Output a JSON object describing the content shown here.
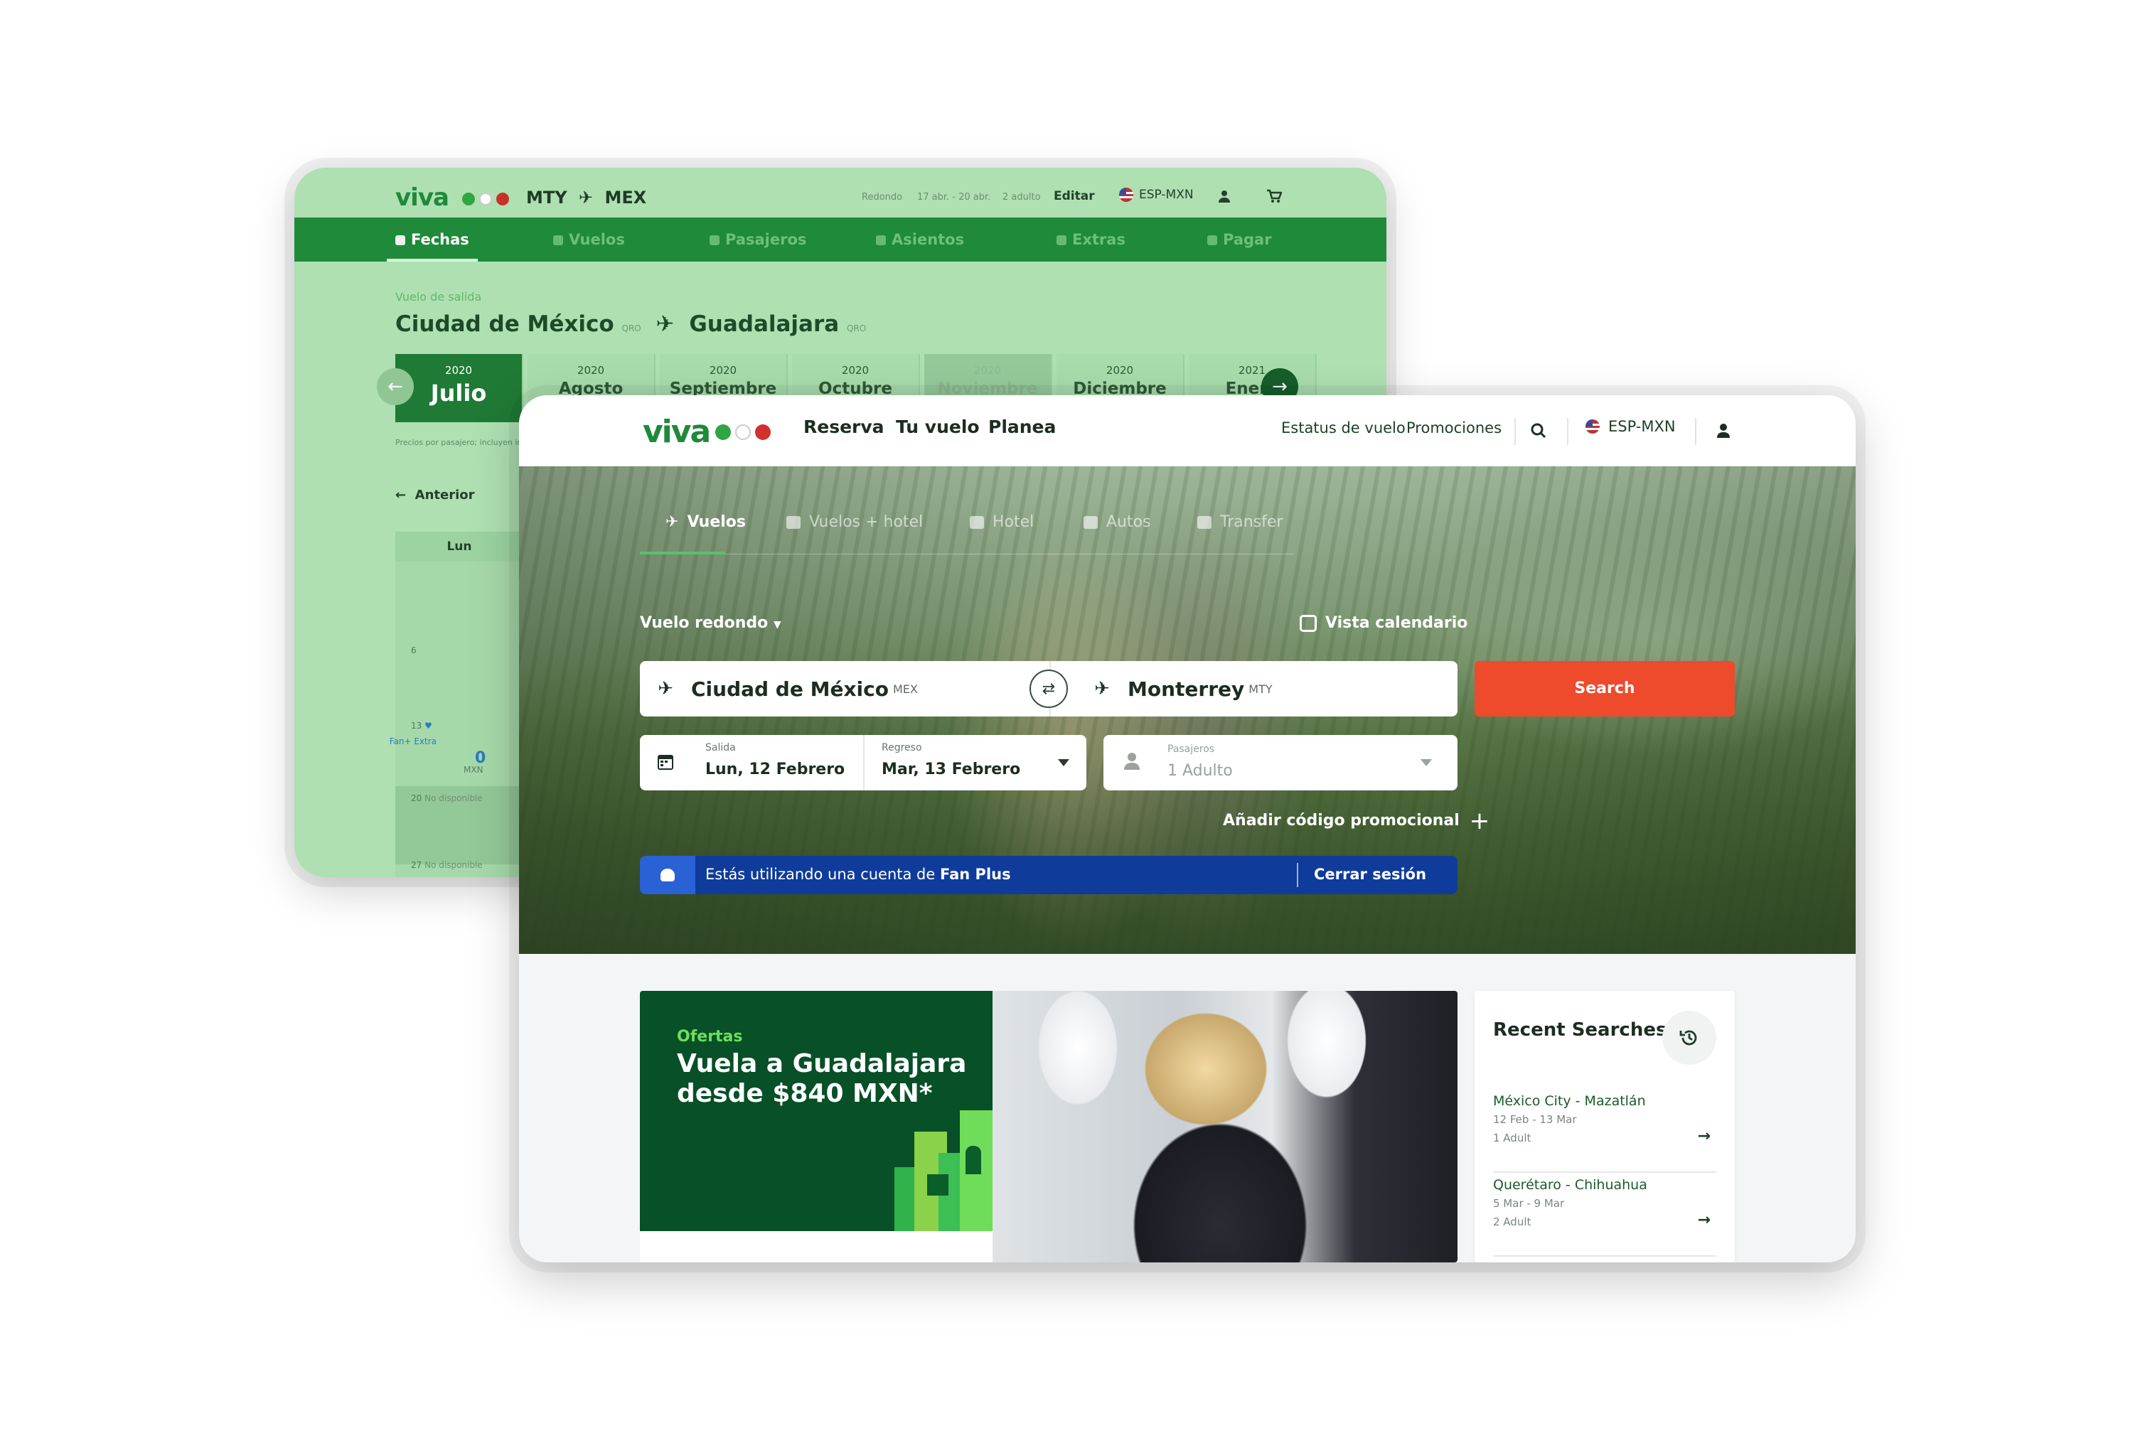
{
  "back": {
    "logo": "viva",
    "route_from": "MTY",
    "route_to": "MEX",
    "trip_type": "Redondo",
    "dates": "17 abr. - 20 abr.",
    "passengers": "2 adulto",
    "edit_label": "Editar",
    "lang": "ESP-MXN",
    "steps": [
      "Fechas",
      "Vuelos",
      "Pasajeros",
      "Asientos",
      "Extras",
      "Pagar"
    ],
    "subtitle": "Vuelo de salida",
    "origin": "Ciudad de México",
    "origin_code": "QRO",
    "destination": "Guadalajara",
    "destination_code": "QRO",
    "months": [
      {
        "year": "2020",
        "name": "Julio"
      },
      {
        "year": "2020",
        "name": "Agosto"
      },
      {
        "year": "2020",
        "name": "Septiembre"
      },
      {
        "year": "2020",
        "name": "Octubre"
      },
      {
        "year": "2020",
        "name": "Noviembre"
      },
      {
        "year": "2020",
        "name": "Diciembre"
      },
      {
        "year": "2021",
        "name": "Enero"
      }
    ],
    "price_note": "Precios por pasajero; incluyen im",
    "prev_label": "Anterior",
    "weekday": "Lun",
    "day_6": "6",
    "day_13": "13",
    "fan_extra": "Fan+ Extra",
    "day_13_price": "0",
    "currency": "MXN",
    "day_20": "20",
    "day_27": "27",
    "not_available": "No disponible"
  },
  "front": {
    "logo": "viva",
    "menu": [
      "Reserva",
      "Tu vuelo",
      "Planea"
    ],
    "links": [
      "Estatus de vuelo",
      "Promociones"
    ],
    "lang": "ESP-MXN",
    "tabs": [
      "Vuelos",
      "Vuelos + hotel",
      "Hotel",
      "Autos",
      "Transfer"
    ],
    "trip_type": "Vuelo redondo",
    "calendar_view": "Vista calendario",
    "origin": "Ciudad de México",
    "origin_code": "MEX",
    "destination": "Monterrey",
    "destination_code": "MTY",
    "search_label": "Search",
    "departure_label": "Salida",
    "departure_value": "Lun, 12 Febrero",
    "return_label": "Regreso",
    "return_value": "Mar, 13 Febrero",
    "pax_label": "Pasajeros",
    "pax_value": "1 Adulto",
    "promo_label": "Añadir código promocional",
    "fan_text": "Estás utilizando una cuenta de",
    "fan_brand": "Fan Plus",
    "logout_label": "Cerrar sesión",
    "offer_label": "Ofertas",
    "offer_title": "Vuela a Guadalajara desde $840 MXN*",
    "recent_title": "Recent Searches",
    "recent": [
      {
        "route": "México City - Mazatlán",
        "dates": "12 Feb - 13 Mar",
        "pax": "1 Adult"
      },
      {
        "route": "Querétaro - Chihuahua",
        "dates": "5 Mar - 9 Mar",
        "pax": "2 Adult"
      }
    ]
  },
  "colors": {
    "brand_green": "#1e8a3a",
    "search_orange": "#ee4a2c",
    "fan_blue": "#0f3c9a"
  }
}
